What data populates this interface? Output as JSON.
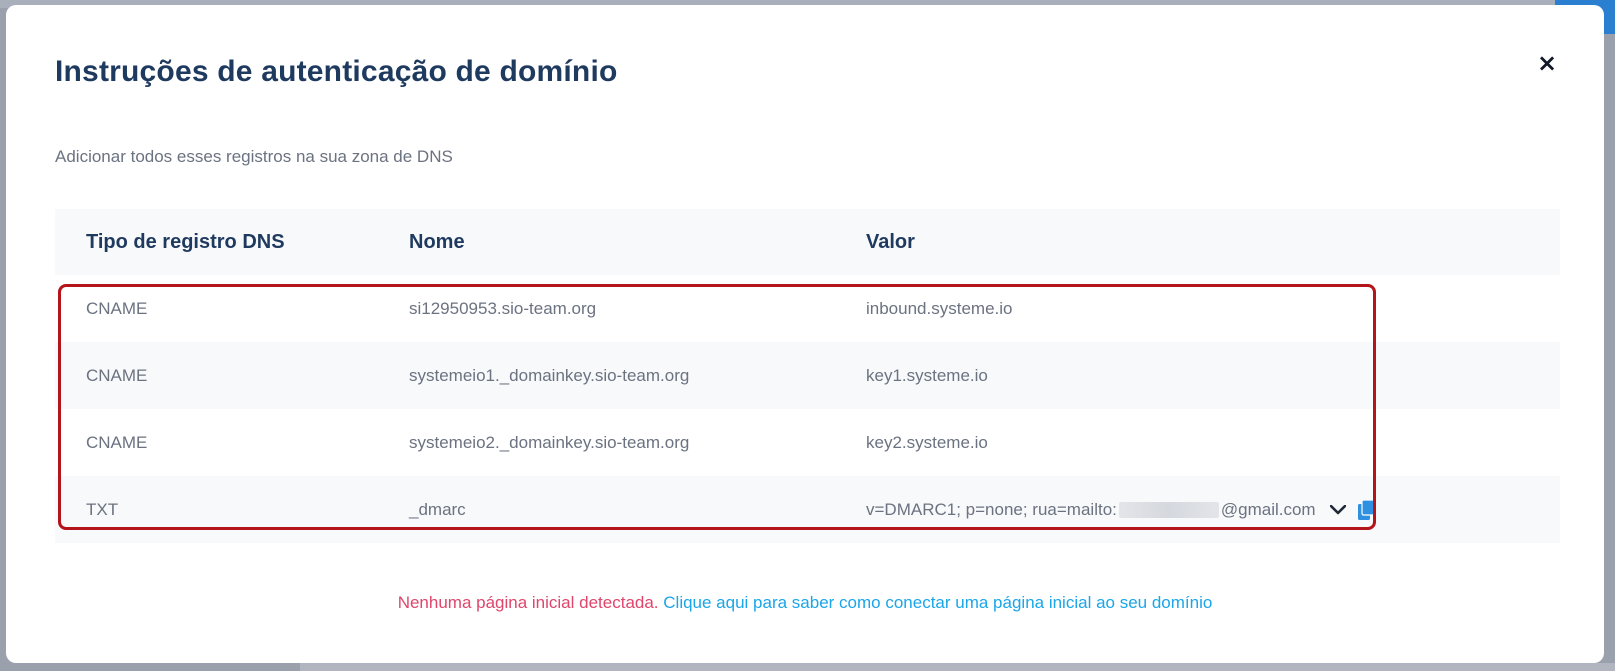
{
  "modal": {
    "title": "Instruções de autenticação de domínio",
    "subtitle": "Adicionar todos esses registros na sua zona de DNS",
    "close_icon": "close-icon"
  },
  "table": {
    "headers": [
      "Tipo de registro DNS",
      "Nome",
      "Valor"
    ],
    "rows": [
      {
        "type": "CNAME",
        "name": "si12950953.sio-team.org",
        "value": "inbound.systeme.io"
      },
      {
        "type": "CNAME",
        "name": "systemeio1._domainkey.sio-team.org",
        "value": "key1.systeme.io"
      },
      {
        "type": "CNAME",
        "name": "systemeio2._domainkey.sio-team.org",
        "value": "key2.systeme.io"
      },
      {
        "type": "TXT",
        "name": "_dmarc",
        "value_prefix": "v=DMARC1; p=none; rua=mailto:",
        "value_suffix": "@gmail.com"
      }
    ]
  },
  "footer": {
    "warning": "Nenhuma página inicial detectada.",
    "link": "Clique aqui para saber como conectar uma página inicial ao seu domínio"
  },
  "colors": {
    "title": "#1f3a5f",
    "warning": "#e0456b",
    "link": "#1aa6e8",
    "highlight_border": "#b3151a",
    "copy_icon": "#2f8fe0"
  }
}
